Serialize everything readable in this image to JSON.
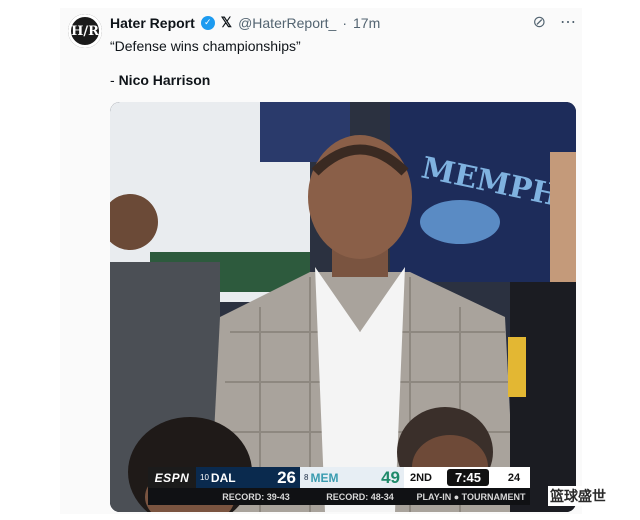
{
  "account": {
    "name": "Hater Report",
    "handle": "@HaterReport_",
    "time": "17m",
    "avatar_text": "H/R"
  },
  "tweet": {
    "text": "“Defense wins championships”",
    "attribution_prefix": "- ",
    "attribution_name": "Nico Harrison"
  },
  "scoreboard": {
    "network": "ESPN",
    "away": {
      "seed": "10",
      "abbr": "DAL",
      "score": "26",
      "record": "RECORD: 39-43"
    },
    "home": {
      "seed": "8",
      "abbr": "MEM",
      "score": "49",
      "record": "RECORD: 48-34"
    },
    "quarter": "2ND",
    "clock": "7:45",
    "shot_clock": "24",
    "event": "PLAY-IN",
    "event_suffix": "TOURNAMENT"
  },
  "watermark": "篮球盛世",
  "icons": [
    "verified-badge-icon",
    "x-logo-icon",
    "grok-icon",
    "more-icon"
  ]
}
